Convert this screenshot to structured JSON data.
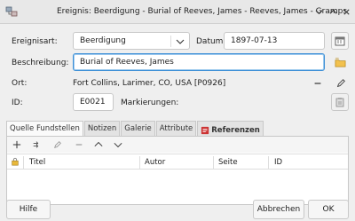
{
  "window": {
    "title": "Ereignis: Beerdigung - Burial of Reeves, James - Reeves, James - Gramps"
  },
  "form": {
    "event_type_label": "Ereignisart:",
    "event_type_value": "Beerdigung",
    "date_label": "Datum:",
    "date_value": "1897-07-13",
    "description_label": "Beschreibung:",
    "description_value": "Burial of Reeves, James",
    "place_label": "Ort:",
    "place_value": "Fort Collins, Larimer, CO, USA [P0926]",
    "id_label": "ID:",
    "id_value": "E0021",
    "tags_label": "Markierungen:"
  },
  "tabs": [
    {
      "label": "Quelle Fundstellen"
    },
    {
      "label": "Notizen"
    },
    {
      "label": "Galerie"
    },
    {
      "label": "Attribute"
    },
    {
      "label": "Referenzen"
    }
  ],
  "table": {
    "columns": [
      "Titel",
      "Autor",
      "Seite",
      "ID"
    ]
  },
  "buttons": {
    "help": "Hilfe",
    "cancel": "Abbrechen",
    "ok": "OK"
  }
}
